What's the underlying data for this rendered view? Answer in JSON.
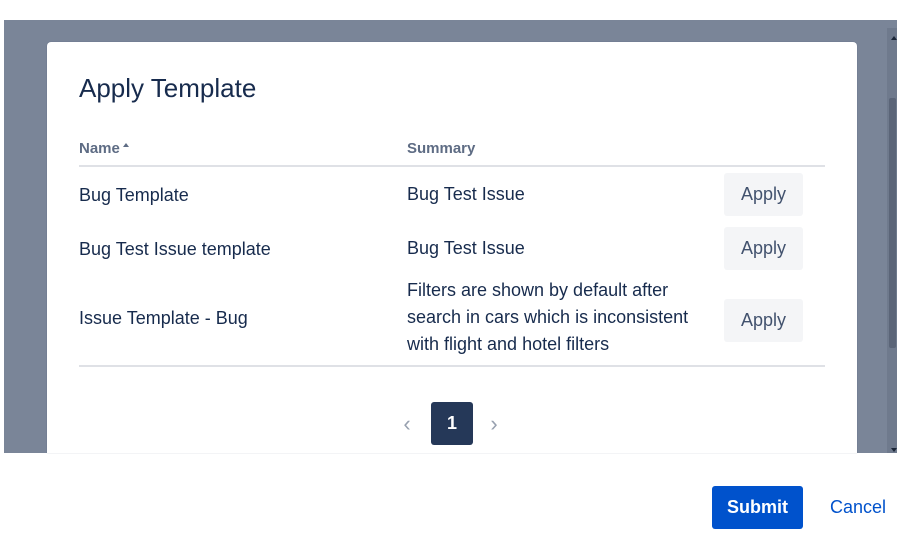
{
  "modal": {
    "title": "Apply Template"
  },
  "table": {
    "columns": {
      "name": "Name",
      "summary": "Summary"
    },
    "sort": {
      "column": "name",
      "direction": "ascending",
      "icon": "sort-ascending-icon"
    },
    "rows": [
      {
        "name": "Bug Template",
        "summary": "Bug Test Issue",
        "action": "Apply"
      },
      {
        "name": "Bug Test Issue template",
        "summary": "Bug Test Issue",
        "action": "Apply"
      },
      {
        "name": "Issue Template - Bug",
        "summary": "Filters are shown by default after search in cars which is inconsistent with flight and hotel filters",
        "action": "Apply"
      }
    ]
  },
  "pagination": {
    "prev_icon": "‹",
    "current_page": "1",
    "next_icon": "›"
  },
  "footer": {
    "submit_label": "Submit",
    "cancel_label": "Cancel"
  },
  "colors": {
    "primary": "#0052cc",
    "page_active": "#253858",
    "backdrop": "#7a8598",
    "text": "#172b4d"
  }
}
